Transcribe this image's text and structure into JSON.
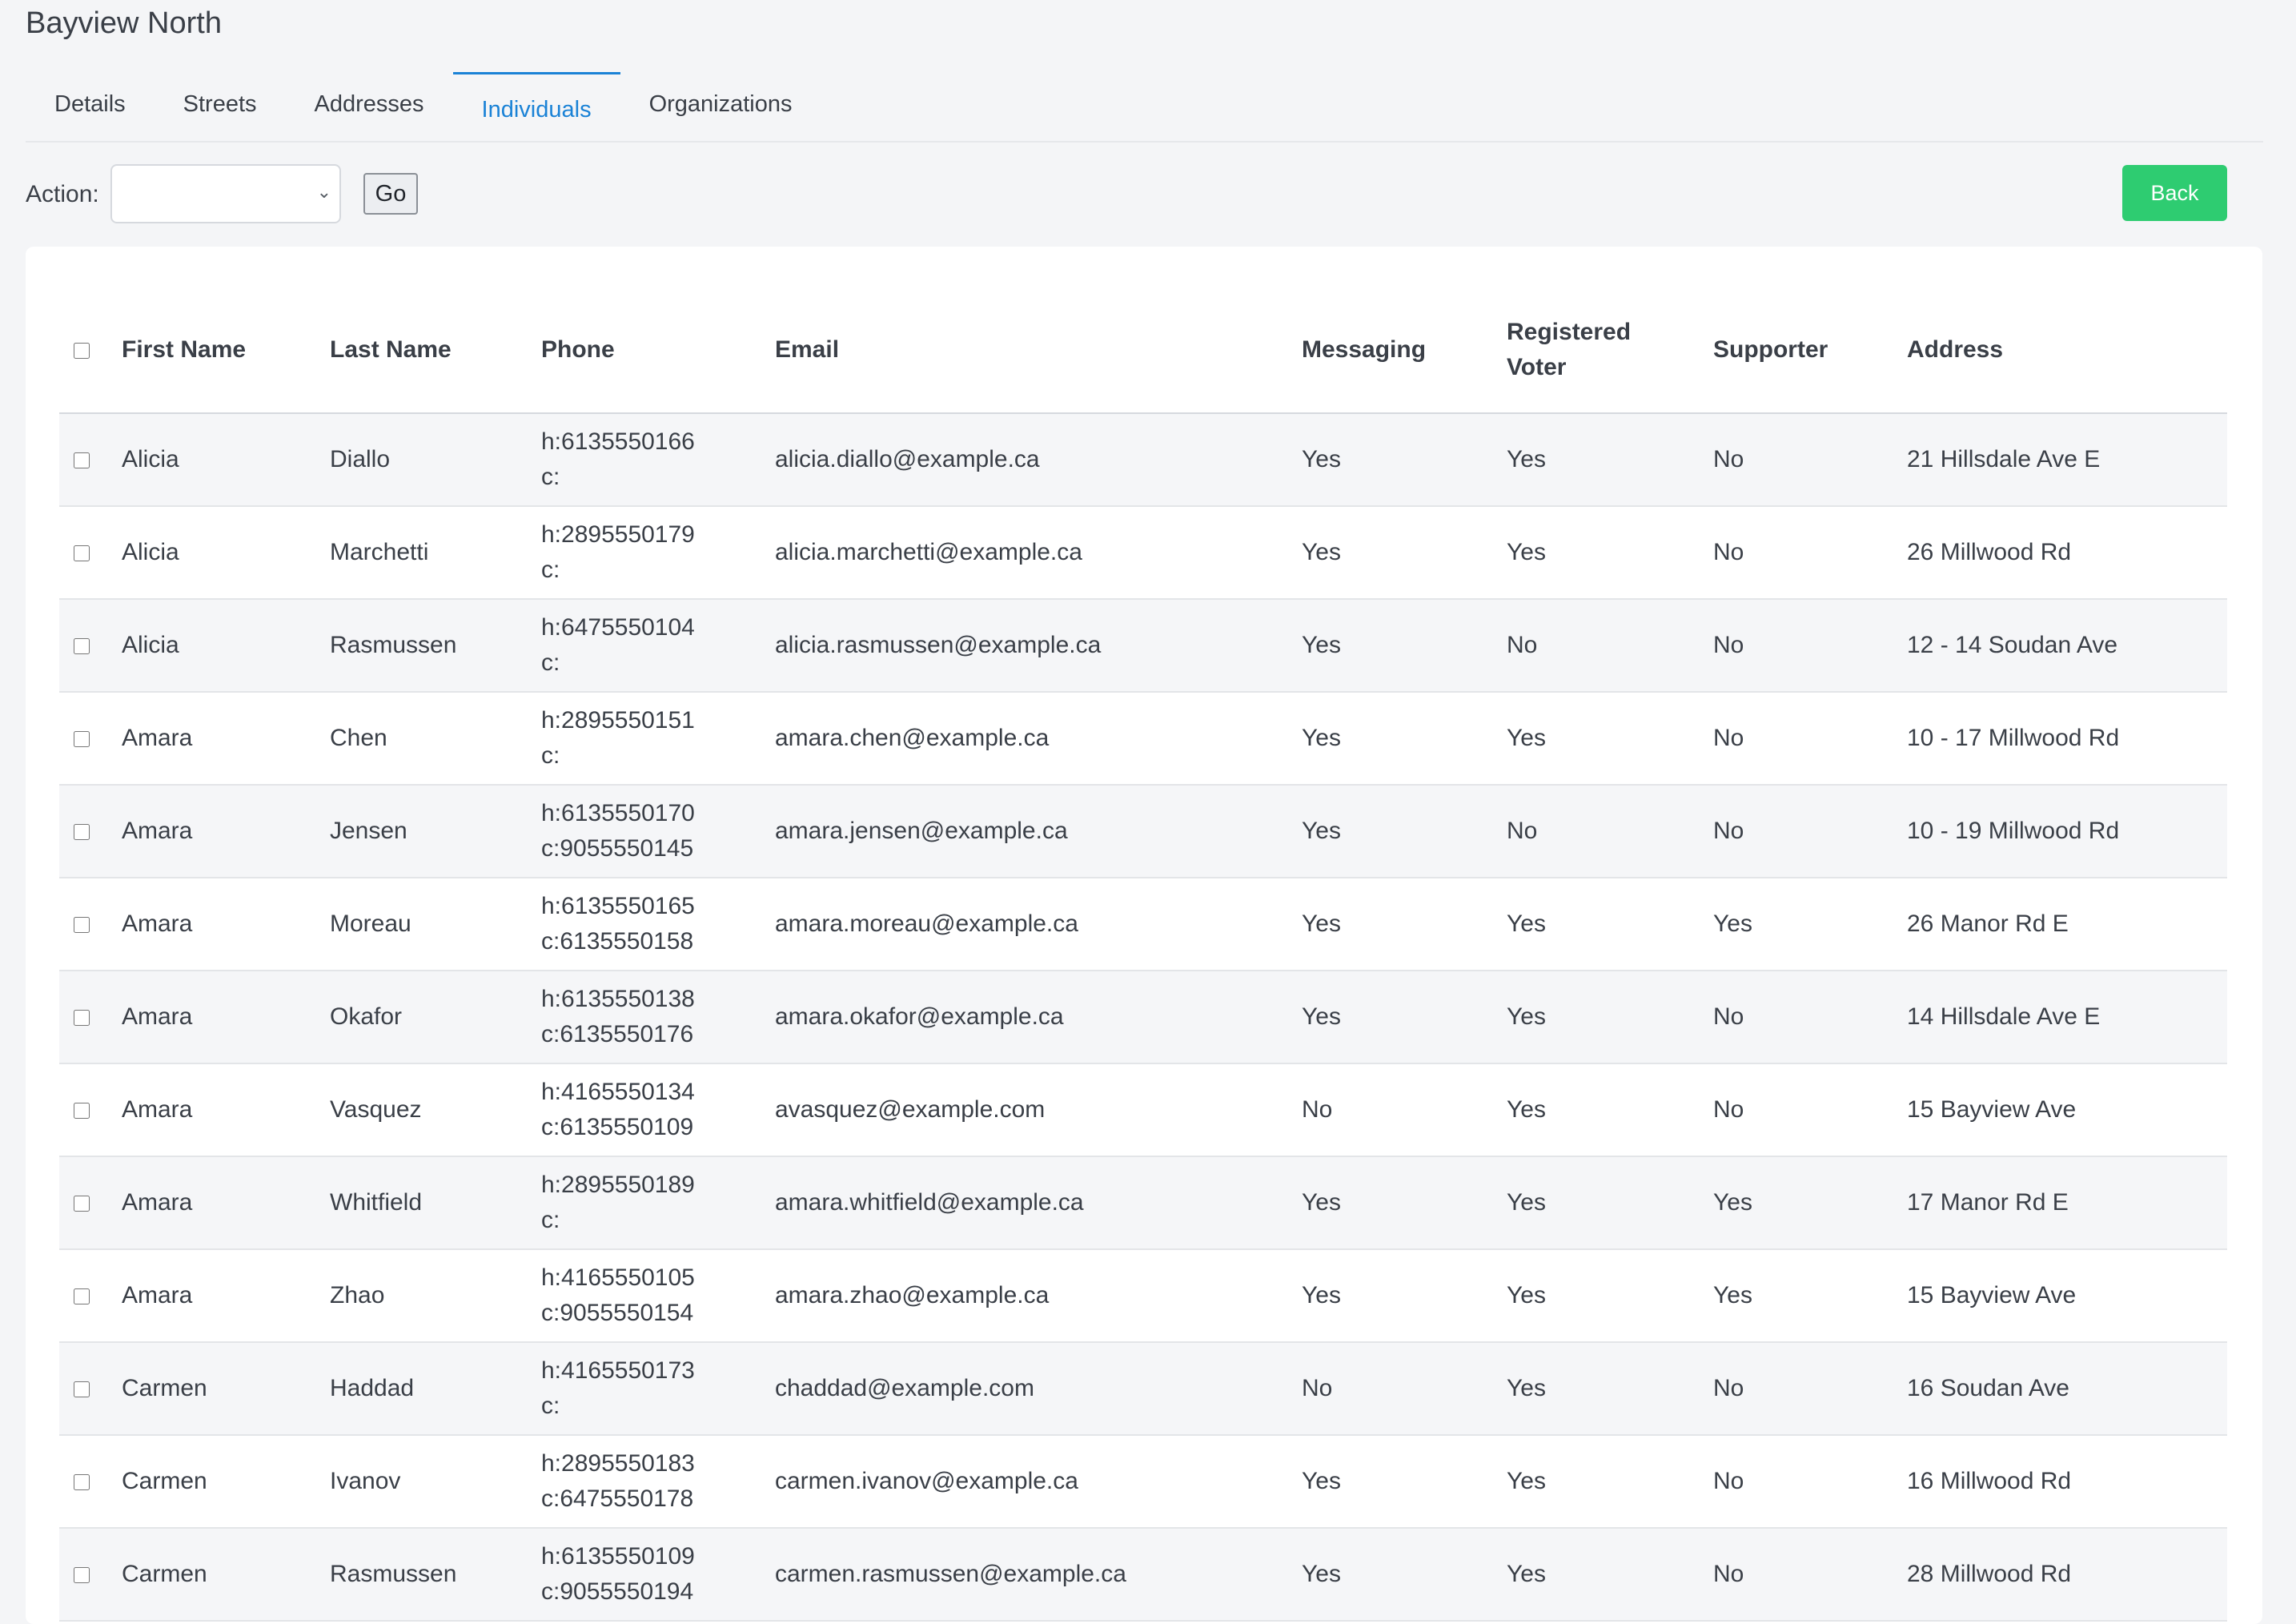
{
  "page": {
    "title": "Bayview North"
  },
  "tabs": [
    {
      "label": "Details",
      "active": false
    },
    {
      "label": "Streets",
      "active": false
    },
    {
      "label": "Addresses",
      "active": false
    },
    {
      "label": "Individuals",
      "active": true
    },
    {
      "label": "Organizations",
      "active": false
    }
  ],
  "toolbar": {
    "action_label": "Action:",
    "action_selected": "",
    "go_label": "Go",
    "back_label": "Back",
    "back_color": "#2ecc71"
  },
  "colors": {
    "active_tab": "#1a82d6",
    "back_button": "#2ecc71"
  },
  "table": {
    "headers": {
      "first_name": "First Name",
      "last_name": "Last Name",
      "phone": "Phone",
      "email": "Email",
      "messaging": "Messaging",
      "registered_voter_line1": "Registered",
      "registered_voter_line2": "Voter",
      "supporter": "Supporter",
      "address": "Address"
    },
    "rows": [
      {
        "first_name": "Alicia",
        "last_name": "Diallo",
        "phone_home": "h:6135550166",
        "phone_cell": "c:",
        "email": "alicia.diallo@example.ca",
        "messaging": "Yes",
        "registered_voter": "Yes",
        "supporter": "No",
        "address": "21 Hillsdale Ave E"
      },
      {
        "first_name": "Alicia",
        "last_name": "Marchetti",
        "phone_home": "h:2895550179",
        "phone_cell": "c:",
        "email": "alicia.marchetti@example.ca",
        "messaging": "Yes",
        "registered_voter": "Yes",
        "supporter": "No",
        "address": "26 Millwood Rd"
      },
      {
        "first_name": "Alicia",
        "last_name": "Rasmussen",
        "phone_home": "h:6475550104",
        "phone_cell": "c:",
        "email": "alicia.rasmussen@example.ca",
        "messaging": "Yes",
        "registered_voter": "No",
        "supporter": "No",
        "address": "12 - 14 Soudan Ave"
      },
      {
        "first_name": "Amara",
        "last_name": "Chen",
        "phone_home": "h:2895550151",
        "phone_cell": "c:",
        "email": "amara.chen@example.ca",
        "messaging": "Yes",
        "registered_voter": "Yes",
        "supporter": "No",
        "address": "10 - 17 Millwood Rd"
      },
      {
        "first_name": "Amara",
        "last_name": "Jensen",
        "phone_home": "h:6135550170",
        "phone_cell": "c:9055550145",
        "email": "amara.jensen@example.ca",
        "messaging": "Yes",
        "registered_voter": "No",
        "supporter": "No",
        "address": "10 - 19 Millwood Rd"
      },
      {
        "first_name": "Amara",
        "last_name": "Moreau",
        "phone_home": "h:6135550165",
        "phone_cell": "c:6135550158",
        "email": "amara.moreau@example.ca",
        "messaging": "Yes",
        "registered_voter": "Yes",
        "supporter": "Yes",
        "address": "26 Manor Rd E"
      },
      {
        "first_name": "Amara",
        "last_name": "Okafor",
        "phone_home": "h:6135550138",
        "phone_cell": "c:6135550176",
        "email": "amara.okafor@example.ca",
        "messaging": "Yes",
        "registered_voter": "Yes",
        "supporter": "No",
        "address": "14 Hillsdale Ave E"
      },
      {
        "first_name": "Amara",
        "last_name": "Vasquez",
        "phone_home": "h:4165550134",
        "phone_cell": "c:6135550109",
        "email": "avasquez@example.com",
        "messaging": "No",
        "registered_voter": "Yes",
        "supporter": "No",
        "address": "15 Bayview Ave"
      },
      {
        "first_name": "Amara",
        "last_name": "Whitfield",
        "phone_home": "h:2895550189",
        "phone_cell": "c:",
        "email": "amara.whitfield@example.ca",
        "messaging": "Yes",
        "registered_voter": "Yes",
        "supporter": "Yes",
        "address": "17 Manor Rd E"
      },
      {
        "first_name": "Amara",
        "last_name": "Zhao",
        "phone_home": "h:4165550105",
        "phone_cell": "c:9055550154",
        "email": "amara.zhao@example.ca",
        "messaging": "Yes",
        "registered_voter": "Yes",
        "supporter": "Yes",
        "address": "15 Bayview Ave"
      },
      {
        "first_name": "Carmen",
        "last_name": "Haddad",
        "phone_home": "h:4165550173",
        "phone_cell": "c:",
        "email": "chaddad@example.com",
        "messaging": "No",
        "registered_voter": "Yes",
        "supporter": "No",
        "address": "16 Soudan Ave"
      },
      {
        "first_name": "Carmen",
        "last_name": "Ivanov",
        "phone_home": "h:2895550183",
        "phone_cell": "c:6475550178",
        "email": "carmen.ivanov@example.ca",
        "messaging": "Yes",
        "registered_voter": "Yes",
        "supporter": "No",
        "address": "16 Millwood Rd"
      },
      {
        "first_name": "Carmen",
        "last_name": "Rasmussen",
        "phone_home": "h:6135550109",
        "phone_cell": "c:9055550194",
        "email": "carmen.rasmussen@example.ca",
        "messaging": "Yes",
        "registered_voter": "Yes",
        "supporter": "No",
        "address": "28 Millwood Rd"
      }
    ]
  }
}
